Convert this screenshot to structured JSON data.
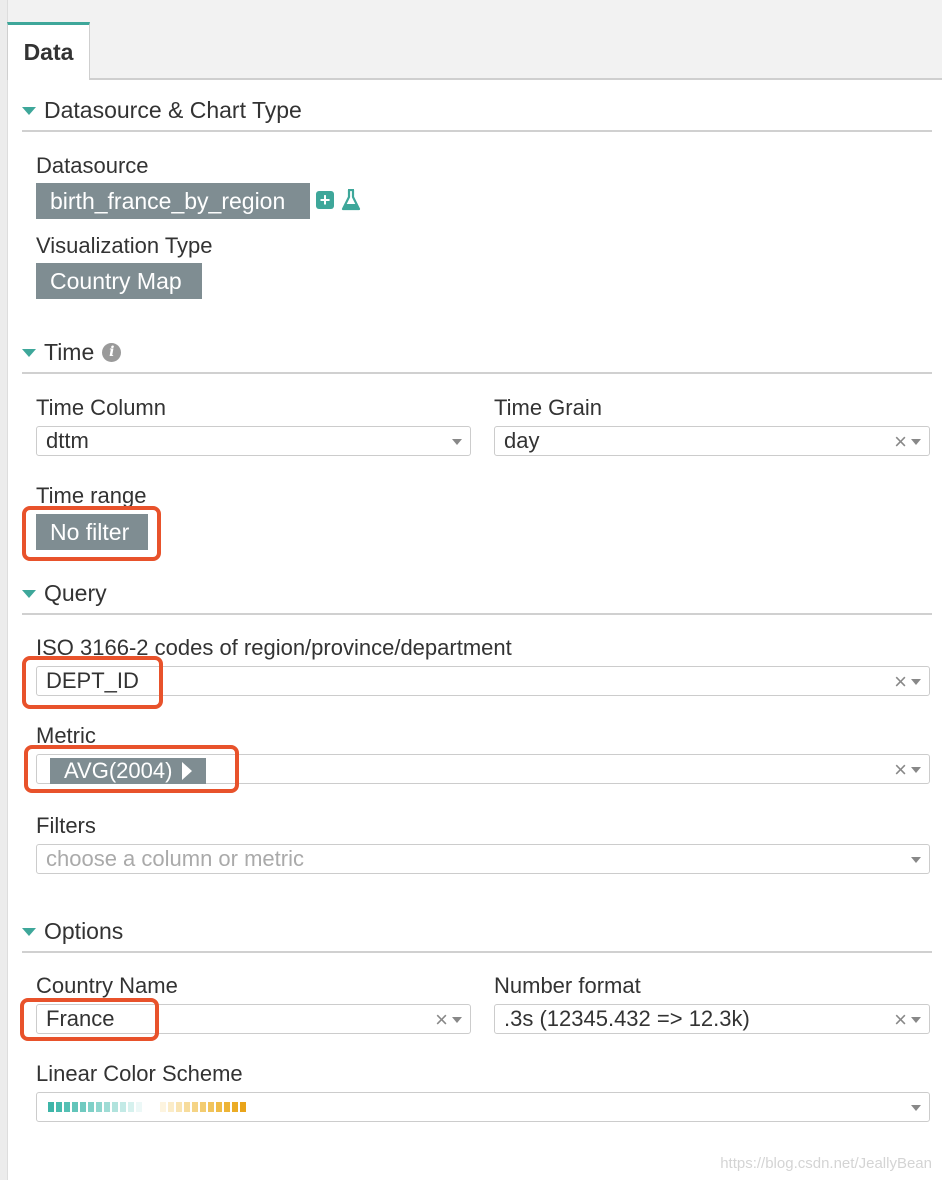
{
  "tabs": {
    "data_label": "Data"
  },
  "sections": {
    "datasource": {
      "title": "Datasource & Chart Type",
      "datasource_label": "Datasource",
      "datasource_value": "birth_france_by_region",
      "viz_type_label": "Visualization Type",
      "viz_type_value": "Country Map"
    },
    "time": {
      "title": "Time",
      "time_column_label": "Time Column",
      "time_column_value": "dttm",
      "time_grain_label": "Time Grain",
      "time_grain_value": "day",
      "time_range_label": "Time range",
      "time_range_value": "No filter"
    },
    "query": {
      "title": "Query",
      "iso_label": "ISO 3166-2 codes of region/province/department",
      "iso_value": "DEPT_ID",
      "metric_label": "Metric",
      "metric_value": "AVG(2004)",
      "filters_label": "Filters",
      "filters_placeholder": "choose a column or metric"
    },
    "options": {
      "title": "Options",
      "country_label": "Country Name",
      "country_value": "France",
      "number_format_label": "Number format",
      "number_format_value": ".3s (12345.432 => 12.3k)",
      "color_scheme_label": "Linear Color Scheme"
    }
  },
  "colors": {
    "accent": "#3ea79a",
    "chip": "#7f8d92",
    "highlight": "#e8522b"
  },
  "icons": {
    "add": "plus-square-icon",
    "explore": "flask-icon",
    "info": "info-circle-icon"
  },
  "clear_glyph": "×",
  "watermark": "https://blog.csdn.net/JeallyBean"
}
